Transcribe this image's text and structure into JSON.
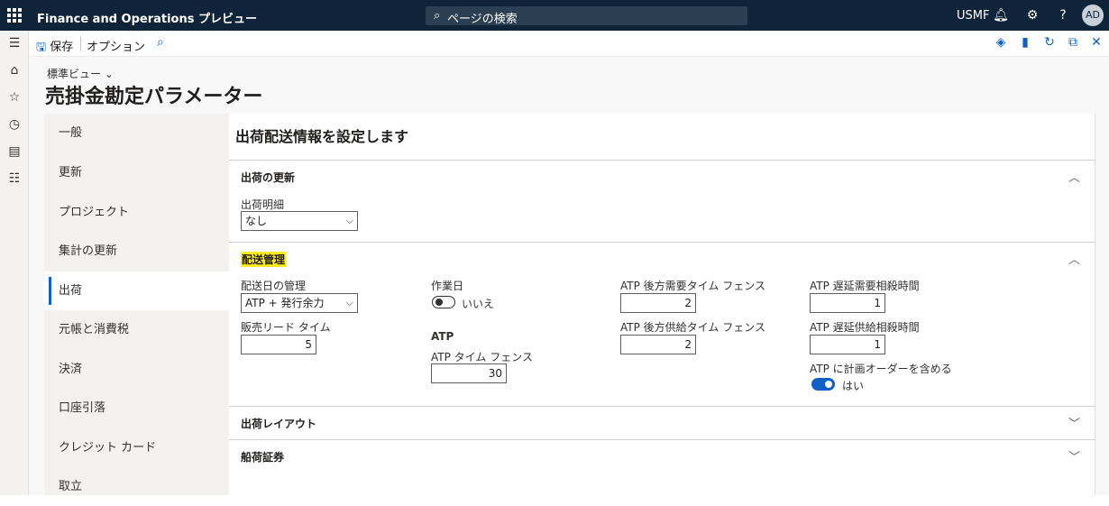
{
  "header": {
    "app_name": "Finance and Operations プレビュー",
    "search_placeholder": "ページの検索",
    "company": "USMF",
    "avatar_initials": "AD"
  },
  "actionbar": {
    "save_label": "保存",
    "options_label": "オプション"
  },
  "page": {
    "view_selector": "標準ビュー",
    "title": "売掛金勘定パラメーター"
  },
  "side_tabs": [
    "一般",
    "更新",
    "プロジェクト",
    "集計の更新",
    "出荷",
    "元帳と消費税",
    "決済",
    "口座引落",
    "クレジット カード",
    "取立"
  ],
  "active_tab": "出荷",
  "panel": {
    "title": "出荷配送情報を設定します",
    "sections": {
      "shipment_update": {
        "label": "出荷の更新",
        "packing_slip_label": "出荷明細",
        "packing_slip_value": "なし"
      },
      "delivery_management": {
        "label": "配送管理",
        "delivery_date_control_label": "配送日の管理",
        "delivery_date_control_value": "ATP + 発行余力",
        "sales_lead_time_label": "販売リード タイム",
        "sales_lead_time_value": "5",
        "working_days_label": "作業日",
        "working_days_value": "いいえ",
        "atp_heading": "ATP",
        "atp_time_fence_label": "ATP タイム フェンス",
        "atp_time_fence_value": "30",
        "atp_backward_demand_label": "ATP 後方需要タイム フェンス",
        "atp_backward_demand_value": "2",
        "atp_backward_supply_label": "ATP 後方供給タイム フェンス",
        "atp_backward_supply_value": "2",
        "atp_delayed_demand_label": "ATP 遅延需要相殺時間",
        "atp_delayed_demand_value": "1",
        "atp_delayed_supply_label": "ATP 遅延供給相殺時間",
        "atp_delayed_supply_value": "1",
        "atp_include_planned_label": "ATP に計画オーダーを含める",
        "atp_include_planned_value": "はい"
      },
      "shipment_layout": {
        "label": "出荷レイアウト"
      },
      "bill_of_lading": {
        "label": "船荷証券"
      }
    }
  },
  "icons": {
    "search": "search-icon",
    "bell": "bell-icon",
    "gear": "gear-icon",
    "help": "help-icon"
  },
  "colors": {
    "topbar": "#0f2438",
    "accent": "#1060c8",
    "highlight": "#ffec1a"
  }
}
